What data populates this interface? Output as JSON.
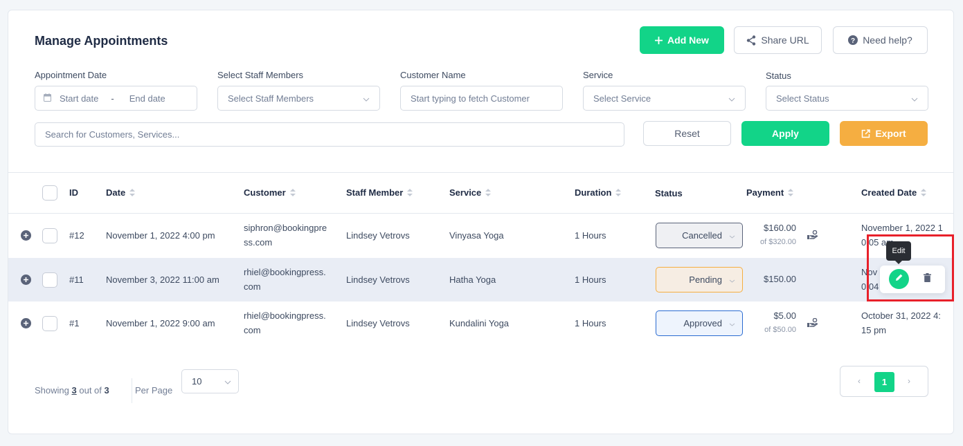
{
  "header": {
    "title": "Manage Appointments",
    "add_new_label": "Add New",
    "share_url_label": "Share URL",
    "need_help_label": "Need help?"
  },
  "filters": {
    "appointment_date": {
      "label": "Appointment Date",
      "start_placeholder": "Start date",
      "separator": "-",
      "end_placeholder": "End date"
    },
    "staff": {
      "label": "Select Staff Members",
      "placeholder": "Select Staff Members"
    },
    "customer": {
      "label": "Customer Name",
      "placeholder": "Start typing to fetch Customer"
    },
    "service": {
      "label": "Service",
      "placeholder": "Select Service"
    },
    "status": {
      "label": "Status",
      "placeholder": "Select Status"
    },
    "search_placeholder": "Search for Customers, Services...",
    "reset_label": "Reset",
    "apply_label": "Apply",
    "export_label": "Export"
  },
  "table": {
    "columns": {
      "id": "ID",
      "date": "Date",
      "customer": "Customer",
      "staff": "Staff Member",
      "service": "Service",
      "duration": "Duration",
      "status": "Status",
      "payment": "Payment",
      "created": "Created Date"
    },
    "rows": [
      {
        "id": "#12",
        "date": "November 1, 2022 4:00 pm",
        "customer_l1": "siphron@bookingpre",
        "customer_l2": "ss.com",
        "staff": "Lindsey Vetrovs",
        "service": "Vinyasa Yoga",
        "duration": "1 Hours",
        "status": "Cancelled",
        "payment": "$160.00",
        "payment_of": "of $320.00",
        "created_l1": "November 1, 2022 1",
        "created_l2": "0:05 am"
      },
      {
        "id": "#11",
        "date": "November 3, 2022 11:00 am",
        "customer_l1": "rhiel@bookingpress.",
        "customer_l2": "com",
        "staff": "Lindsey Vetrovs",
        "service": "Hatha Yoga",
        "duration": "1 Hours",
        "status": "Pending",
        "payment": "$150.00",
        "payment_of": "",
        "created_l1": "Nov",
        "created_l2": "0:04"
      },
      {
        "id": "#1",
        "date": "November 1, 2022 9:00 am",
        "customer_l1": "rhiel@bookingpress.",
        "customer_l2": "com",
        "staff": "Lindsey Vetrovs",
        "service": "Kundalini Yoga",
        "duration": "1 Hours",
        "status": "Approved",
        "payment": "$5.00",
        "payment_of": "of $50.00",
        "created_l1": "October 31, 2022 4:",
        "created_l2": "15 pm"
      }
    ]
  },
  "row_actions": {
    "tooltip": "Edit",
    "edit_icon": "pencil-icon",
    "delete_icon": "trash-icon"
  },
  "footer": {
    "showing_prefix": "Showing",
    "showing_count": "3",
    "showing_mid": "out of",
    "showing_total": "3",
    "per_page_label": "Per Page",
    "per_page_value": "10",
    "prev": "‹",
    "current_page": "1",
    "next": "›"
  },
  "colors": {
    "primary": "#12d488",
    "warning": "#f5ae41",
    "cancelled_border": "#5a6379",
    "pending_border": "#f5ae41",
    "approved_border": "#2a6bd1",
    "highlight": "#e8202a"
  }
}
